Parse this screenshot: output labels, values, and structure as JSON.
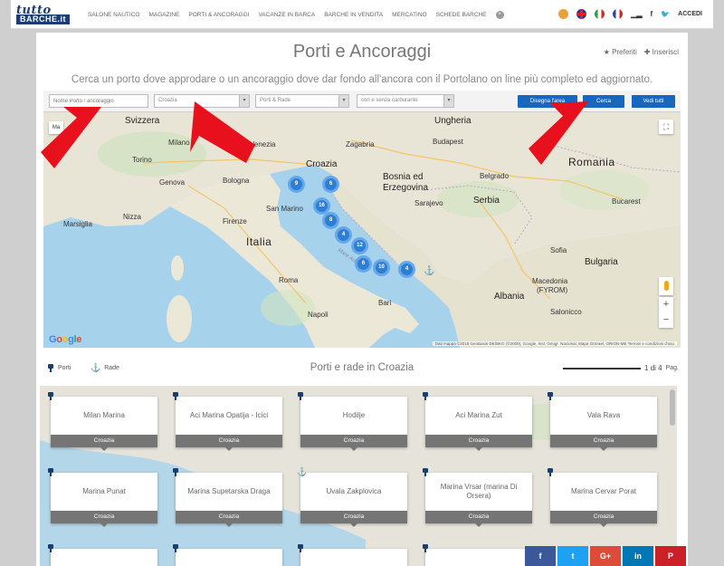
{
  "header": {
    "logo_line1": "tutto",
    "logo_line2": "BARCHE.it",
    "nav": [
      "SALONE NAUTICO",
      "MAGAZINE",
      "PORTI & ANCORAGGI",
      "VACANZE IN BARCA",
      "BARCHE IN VENDITA",
      "MERCATINO",
      "SCHEDE BARCHE"
    ],
    "close_glyph": "×",
    "boat_glyph": "▁▂",
    "facebook": "f",
    "twitter": "🐦",
    "login": "ACCEDI"
  },
  "page": {
    "title": "Porti e Ancoraggi",
    "favorites": "Preferiti",
    "insert": "Inserisci",
    "favorites_glyph": "★",
    "insert_glyph": "✚",
    "subtitle": "Cerca un porto dove approdare o un ancoraggio dove dar fondo all'ancora con il Portolano on line più completo ed aggiornato."
  },
  "filters": {
    "name_placeholder": "Nome Porto / ancoraggio",
    "country": "Croazia",
    "type": "Porti & Rade",
    "fuel": "con e senza carburante",
    "draw_area": "Disegna l'area",
    "search": "Cerca",
    "show_all": "Vedi tutti"
  },
  "map": {
    "type_button": "Ma",
    "fullscreen_glyph": "⛶",
    "zoom_in": "+",
    "zoom_out": "−",
    "google": [
      "G",
      "o",
      "o",
      "g",
      "l",
      "e"
    ],
    "google_colors": [
      "#4285f4",
      "#ea4335",
      "#fbbc05",
      "#4285f4",
      "#34a853",
      "#ea4335"
    ],
    "attribution": "Dati mappa ©2018 GeoBasis-DE/BKG (©2009), Google, Inst. Geogr. Nacional, Mapa GISrael, ORION-ME   Termini e condizioni d'uso",
    "labels": {
      "svizzera": "Svizzera",
      "milano": "Milano",
      "torino": "Torino",
      "genova": "Genova",
      "bologna": "Bologna",
      "venezia": "Venezia",
      "firenze": "Firenze",
      "san_marino": "San Marino",
      "italia": "Italia",
      "marsiglia": "Marsiglia",
      "nizza": "Nizza",
      "roma": "Roma",
      "napoli": "Napoli",
      "bari": "Bari",
      "croazia": "Croazia",
      "zagabria": "Zagabria",
      "ungheria": "Ungheria",
      "budapest": "Budapest",
      "bosnia_1": "Bosnia ed",
      "bosnia_2": "Erzegovina",
      "sarajevo": "Sarajevo",
      "serbia": "Serbia",
      "belgrado": "Belgrado",
      "romania": "Romania",
      "bucarest": "Bucarest",
      "bulgaria": "Bulgaria",
      "sofia": "Sofia",
      "albania": "Albania",
      "fyrom_1": "Macedonia",
      "fyrom_2": "(FYROM)",
      "salonicco": "Salonicco",
      "sea": "Mare Adriatico",
      "anchor_glyph": "⚓"
    },
    "clusters": [
      "9",
      "6",
      "16",
      "8",
      "4",
      "12",
      "6",
      "10",
      "4"
    ]
  },
  "list": {
    "legend_ports": "Porti",
    "legend_anchorages": "Rade",
    "anchor_glyph": "⚓",
    "title": "Porti e rade in Croazia",
    "page_current": "1 di 4",
    "page_label": "Pag."
  },
  "tiles": [
    {
      "name": "Milan Marina",
      "country": "Croazia",
      "kind": "port"
    },
    {
      "name": "Aci Marina Opatija - Icici",
      "country": "Croazia",
      "kind": "port"
    },
    {
      "name": "Hodilje",
      "country": "Croazia",
      "kind": "port"
    },
    {
      "name": "Aci Marina Zut",
      "country": "Croazia",
      "kind": "port"
    },
    {
      "name": "Vala Rava",
      "country": "Croazia",
      "kind": "port"
    },
    {
      "name": "Marina Punat",
      "country": "Croazia",
      "kind": "port"
    },
    {
      "name": "Marina Supetarska Draga",
      "country": "Croazia",
      "kind": "port"
    },
    {
      "name": "Uvala Zakplovica",
      "country": "Croazia",
      "kind": "anchorage"
    },
    {
      "name": "Marina Vrsar (marina Di Orsera)",
      "country": "Croazia",
      "kind": "port"
    },
    {
      "name": "Marina Cervar Porat",
      "country": "Croazia",
      "kind": "port"
    }
  ],
  "share": [
    {
      "label": "f",
      "color": "#3b5998"
    },
    {
      "label": "t",
      "color": "#1da1f2"
    },
    {
      "label": "G+",
      "color": "#dd4b39"
    },
    {
      "label": "in",
      "color": "#0077b5"
    },
    {
      "label": "P",
      "color": "#cb2027"
    }
  ],
  "colors": {
    "accent": "#1766c0",
    "brand": "#1a3d73",
    "cluster": "#2d7fd4",
    "sea": "#a7d2ec",
    "annotation_arrow": "#e8101c"
  }
}
